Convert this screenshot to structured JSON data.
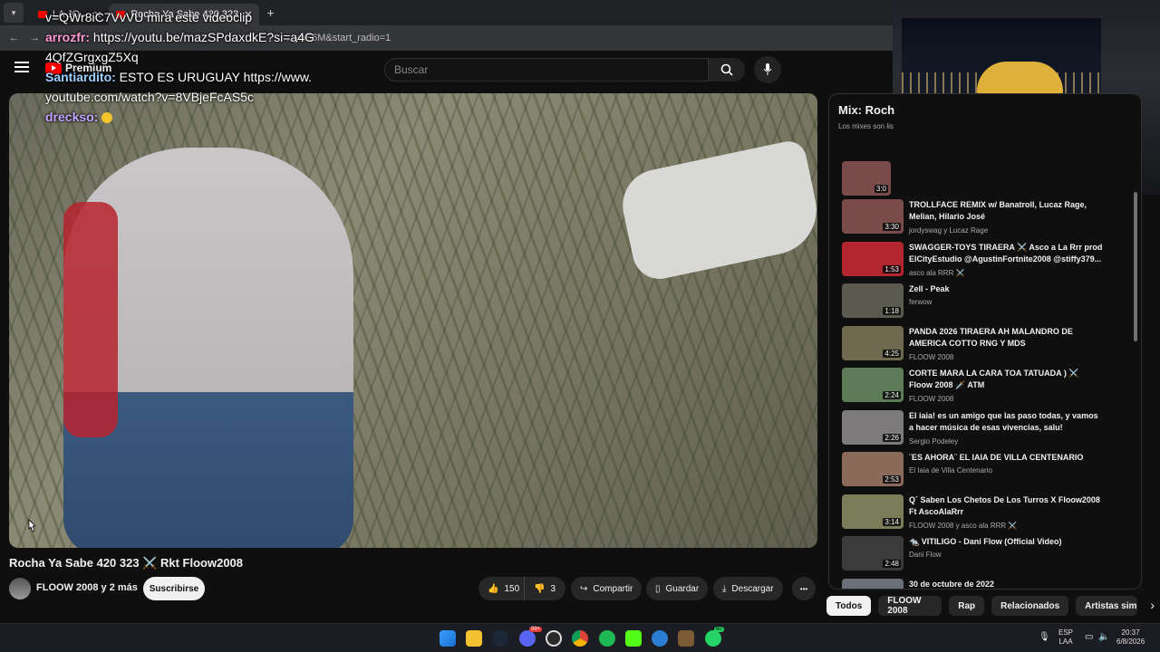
{
  "browser": {
    "tabs": [
      {
        "label": "LA JO..."
      },
      {
        "label": "Rocha Ya Sabe 420 323"
      }
    ],
    "new_tab": "+",
    "url": "...ynE6M&start_radio=1"
  },
  "youtube": {
    "premium_label": "Premium",
    "search_placeholder": "Buscar"
  },
  "chat": [
    {
      "user": "",
      "text": "v=QWr8iC7VvVU mira este videoclip",
      "color": "plain"
    },
    {
      "user": "arrozfr:",
      "text": "https://youtu.be/mazSPdaxdkE?si=a4G4QfZGrgxgZ5Xq",
      "color": "pink"
    },
    {
      "user": "Santiardito:",
      "text": "ESTO ES URUGUAY https://www.youtube.com/watch?v=8VBjeFcAS5c",
      "color": "blue"
    },
    {
      "user": "dreckso:",
      "text": "",
      "color": "purple"
    }
  ],
  "video": {
    "title": "Rocha Ya Sabe 420 323 ⚔️ Rkt Floow2008",
    "channel": "FLOOW 2008 y 2 más",
    "subscribe": "Suscribirse",
    "likes": "150",
    "dislikes": "3",
    "share": "Compartir",
    "save": "Guardar",
    "download": "Descargar",
    "more": "•••"
  },
  "mix": {
    "title": "Mix: Roch",
    "subtitle": "Los mixes son lis",
    "current_duration": "3:0",
    "items": [
      {
        "title": "TROLLFACE REMIX w/ Banatroll, Lucaz Rage, Melian, Hilario José",
        "channel": "jordyswag y Lucaz Rage",
        "duration": "3:30",
        "thumb": "#7a4b4b"
      },
      {
        "title": "SWAGGER-TOYS TIRAERA ⚔️ Asco a La Rrr prod ElCityEstudio @AgustinFortnite2008 @stiffy379...",
        "channel": "asco ala RRR ⚔️",
        "duration": "1:53",
        "thumb": "#b3262e"
      },
      {
        "title": "Zell - Peak",
        "channel": "ferwow",
        "duration": "1:18",
        "thumb": "#5a5a4e"
      },
      {
        "title": "PANDA 2026 TIRAERA AH MALANDRO DE AMERICA COTTO RNG Y MDS",
        "channel": "FLOOW 2008",
        "duration": "4:25",
        "thumb": "#6f6a4f"
      },
      {
        "title": "CORTE MARA LA CARA TOA TATUADA ) ⚔️ Floow 2008 🗡️ ATM",
        "channel": "FLOOW 2008",
        "duration": "2:24",
        "thumb": "#5e7b57"
      },
      {
        "title": "El iaia! es un amigo que las paso todas, y vamos a hacer música de esas vivencias, salu!",
        "channel": "Sergio Podeley",
        "duration": "2:26",
        "thumb": "#7c7a7a"
      },
      {
        "title": "¨ES AHORA¨ EL IAIA DE VILLA CENTENARIO",
        "channel": "El Iaia de Villa Centenario",
        "duration": "2:53",
        "thumb": "#8b6a5a"
      },
      {
        "title": "Q´ Saben Los Chetos De Los Turros X Floow2008 Ft AscoAlaRrr",
        "channel": "FLOOW 2008 y asco ala RRR ⚔️",
        "duration": "3:14",
        "thumb": "#7b7d59"
      },
      {
        "title": "🐀 VITILIGO - Dani Flow (Official Video)",
        "channel": "Dani Flow",
        "duration": "2:48",
        "thumb": "#3b3b3b"
      },
      {
        "title": "30 de octubre de 2022",
        "channel": "",
        "duration": "",
        "thumb": "#6a7078"
      }
    ]
  },
  "chips": [
    "Todos",
    "FLOOW 2008",
    "Rap",
    "Relacionados",
    "Artistas similar"
  ],
  "taskbar": {
    "lang_top": "ESP",
    "lang_bottom": "LAA",
    "time": "20:37",
    "date": "6/8/2026",
    "badge_discord": "99+",
    "badge_whatsapp": "60"
  }
}
